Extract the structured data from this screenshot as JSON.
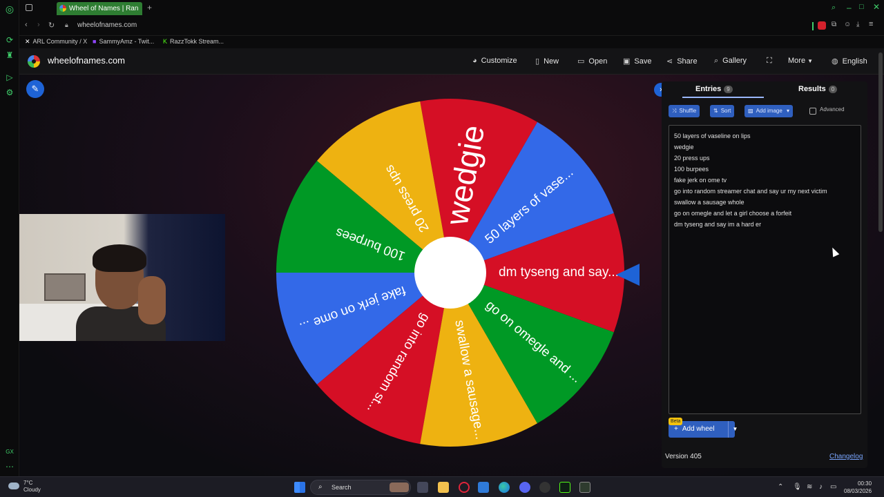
{
  "browser": {
    "tab_title": "Wheel of Names | Ran",
    "url": "wheelofnames.com",
    "bookmarks": [
      "ARL Community / X",
      "SammyAmz - Twit...",
      "RazzTokk Stream..."
    ]
  },
  "site": {
    "title": "wheelofnames.com",
    "nav": {
      "customize": "Customize",
      "new": "New",
      "open": "Open",
      "save": "Save",
      "share": "Share",
      "gallery": "Gallery",
      "more": "More",
      "language": "English"
    }
  },
  "wheel": {
    "segments": [
      {
        "label": "50 layers of vase...",
        "color": "#3369e8"
      },
      {
        "label": "wedgie",
        "color": "#d50f25"
      },
      {
        "label": "20 press ups",
        "color": "#eeb211"
      },
      {
        "label": "100 burpees",
        "color": "#009925"
      },
      {
        "label": "fake jerk on ome ...",
        "color": "#3369e8"
      },
      {
        "label": "go into random st...",
        "color": "#d50f25"
      },
      {
        "label": "swallow a sausage...",
        "color": "#eeb211"
      },
      {
        "label": "go on omegle and ...",
        "color": "#009925"
      },
      {
        "label": "dm tyseng and say...",
        "color": "#d50f25"
      }
    ]
  },
  "panel": {
    "tab_entries": "Entries",
    "entries_count": "9",
    "tab_results": "Results",
    "results_count": "0",
    "shuffle": "Shuffle",
    "sort": "Sort",
    "add_image": "Add image",
    "advanced": "Advanced",
    "entries": [
      "50 layers of vaseline on lips",
      "wedgie",
      "20 press ups",
      "100 burpees",
      "fake jerk on ome tv",
      "go into random streamer chat and say ur my next victim",
      "swallow a sausage whole",
      "go on omegle and let a girl choose a forfeit",
      "dm tyseng and say im a hard er"
    ],
    "beta": "Beta",
    "add_wheel": "Add wheel",
    "version": "Version 405",
    "changelog": "Changelog"
  },
  "taskbar": {
    "temperature": "7°C",
    "weather": "Cloudy",
    "search_placeholder": "Search",
    "time": "00:30",
    "date": "08/03/2026"
  },
  "icons": {
    "edit": "pencil-icon",
    "collapse": "chevron-right-icon"
  }
}
